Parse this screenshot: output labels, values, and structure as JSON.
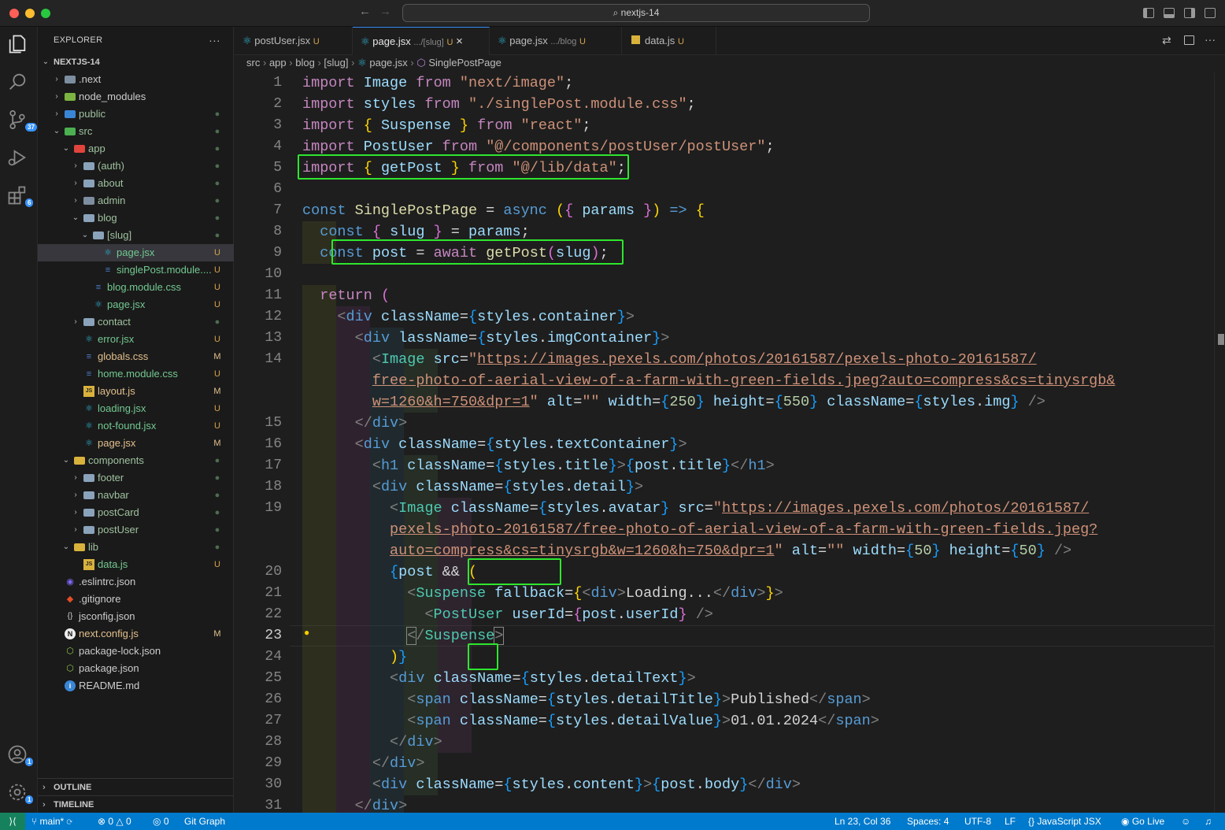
{
  "window": {
    "search": "nextjs-14"
  },
  "sidebar": {
    "title": "EXPLORER",
    "more": "···",
    "root": "NEXTJS-14",
    "items": [
      {
        "label": ".next",
        "status": ""
      },
      {
        "label": "node_modules",
        "status": ""
      },
      {
        "label": "public",
        "status": "●"
      },
      {
        "label": "src",
        "status": "●"
      },
      {
        "label": "app",
        "status": "●"
      },
      {
        "label": "(auth)",
        "status": "●"
      },
      {
        "label": "about",
        "status": "●"
      },
      {
        "label": "admin",
        "status": "●"
      },
      {
        "label": "blog",
        "status": "●"
      },
      {
        "label": "[slug]",
        "status": "●"
      },
      {
        "label": "page.jsx",
        "status": "U"
      },
      {
        "label": "singlePost.module....",
        "status": "U"
      },
      {
        "label": "blog.module.css",
        "status": "U"
      },
      {
        "label": "page.jsx",
        "status": "U"
      },
      {
        "label": "contact",
        "status": "●"
      },
      {
        "label": "error.jsx",
        "status": "U"
      },
      {
        "label": "globals.css",
        "status": "M"
      },
      {
        "label": "home.module.css",
        "status": "U"
      },
      {
        "label": "layout.js",
        "status": "M"
      },
      {
        "label": "loading.jsx",
        "status": "U"
      },
      {
        "label": "not-found.jsx",
        "status": "U"
      },
      {
        "label": "page.jsx",
        "status": "M"
      },
      {
        "label": "components",
        "status": "●"
      },
      {
        "label": "footer",
        "status": "●"
      },
      {
        "label": "navbar",
        "status": "●"
      },
      {
        "label": "postCard",
        "status": "●"
      },
      {
        "label": "postUser",
        "status": "●"
      },
      {
        "label": "lib",
        "status": "●"
      },
      {
        "label": "data.js",
        "status": "U"
      },
      {
        "label": ".eslintrc.json",
        "status": ""
      },
      {
        "label": ".gitignore",
        "status": ""
      },
      {
        "label": "jsconfig.json",
        "status": ""
      },
      {
        "label": "next.config.js",
        "status": "M"
      },
      {
        "label": "package-lock.json",
        "status": ""
      },
      {
        "label": "package.json",
        "status": ""
      },
      {
        "label": "README.md",
        "status": ""
      }
    ],
    "outline": "OUTLINE",
    "timeline": "TIMELINE"
  },
  "activity": {
    "scm_badge": "37",
    "ext_badge": "6",
    "account_badge": "1",
    "settings_badge": "1"
  },
  "tabs": [
    {
      "label": "postUser.jsx",
      "desc": "",
      "status": "U"
    },
    {
      "label": "page.jsx",
      "desc": ".../[slug]",
      "status": "U",
      "close": "×"
    },
    {
      "label": "page.jsx",
      "desc": ".../blog",
      "status": "U"
    },
    {
      "label": "data.js",
      "desc": "",
      "status": "U"
    }
  ],
  "breadcrumb": [
    "src",
    "app",
    "blog",
    "[slug]",
    "page.jsx",
    "SinglePostPage"
  ],
  "editor": {
    "line_numbers": [
      "1",
      "2",
      "3",
      "4",
      "5",
      "6",
      "7",
      "8",
      "9",
      "10",
      "11",
      "12",
      "13",
      "14",
      "",
      "",
      "15",
      "16",
      "17",
      "18",
      "19",
      "",
      "",
      "20",
      "21",
      "22",
      "23",
      "24",
      "25",
      "26",
      "27",
      "28",
      "29",
      "30",
      "31"
    ],
    "current_line": "23"
  },
  "status": {
    "remote": "⟩⟨",
    "branch": "main*",
    "problems_errors": "0",
    "problems_warnings": "0",
    "ports": "0",
    "git_graph": "Git Graph",
    "cursor": "Ln 23, Col 36",
    "spaces": "Spaces: 4",
    "encoding": "UTF-8",
    "eol": "LF",
    "language": "JavaScript JSX",
    "golive": "Go Live"
  }
}
